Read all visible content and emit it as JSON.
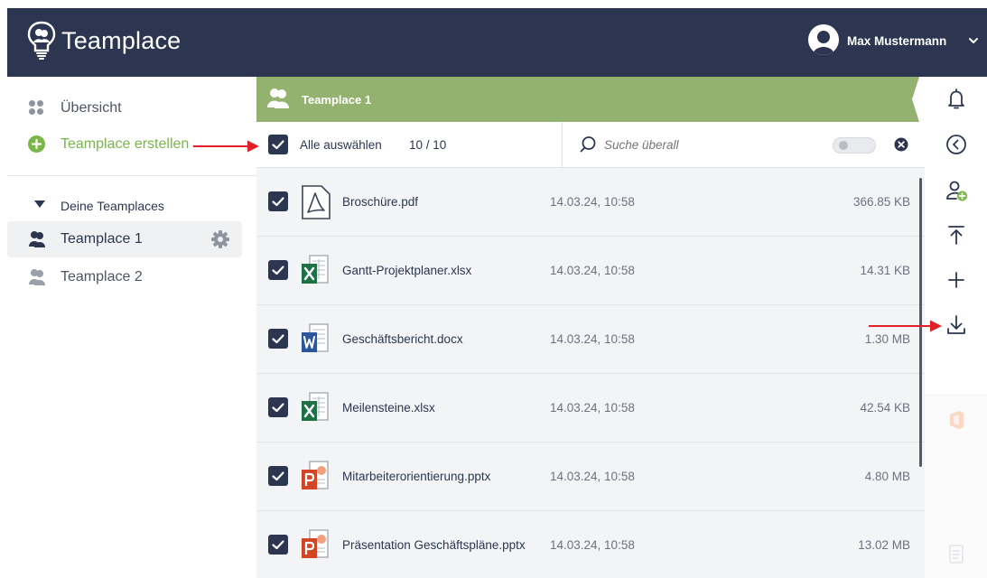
{
  "header": {
    "app_name": "Teamplace",
    "user_name": "Max Mustermann"
  },
  "sidebar": {
    "overview_label": "Übersicht",
    "create_label": "Teamplace erstellen",
    "section_label": "Deine Teamplaces",
    "teamplaces": [
      {
        "label": "Teamplace 1",
        "active": true
      },
      {
        "label": "Teamplace 2",
        "active": false
      }
    ]
  },
  "content": {
    "current_teamplace": "Teamplace 1",
    "select_all_label": "Alle auswählen",
    "selected_count": "10 / 10",
    "search_placeholder": "Suche überall",
    "files": [
      {
        "name": "Broschüre.pdf",
        "date": "14.03.24, 10:58",
        "size": "366.85 KB",
        "type": "pdf",
        "checked": true
      },
      {
        "name": "Gantt-Projektplaner.xlsx",
        "date": "14.03.24, 10:58",
        "size": "14.31 KB",
        "type": "xlsx",
        "checked": true
      },
      {
        "name": "Geschäftsbericht.docx",
        "date": "14.03.24, 10:58",
        "size": "1.30 MB",
        "type": "docx",
        "checked": true
      },
      {
        "name": "Meilensteine.xlsx",
        "date": "14.03.24, 10:58",
        "size": "42.54 KB",
        "type": "xlsx",
        "checked": true
      },
      {
        "name": "Mitarbeiterorientierung.pptx",
        "date": "14.03.24, 10:58",
        "size": "4.80 MB",
        "type": "pptx",
        "checked": true
      },
      {
        "name": "Präsentation Geschäftspläne.pptx",
        "date": "14.03.24, 10:58",
        "size": "13.02 MB",
        "type": "pptx",
        "checked": true
      }
    ]
  },
  "right_rail": {
    "icons": [
      "bell-icon",
      "back-circle-icon",
      "add-member-icon",
      "upload-icon",
      "plus-icon",
      "download-icon",
      "office-icon",
      "clipboard-icon"
    ]
  },
  "colors": {
    "header": "#2c3650",
    "accent_green": "#94b26f",
    "create_green": "#7ab648",
    "annotation_red": "#e01f26",
    "excel": "#1d7145",
    "word": "#2b579a",
    "powerpoint": "#d24625"
  }
}
